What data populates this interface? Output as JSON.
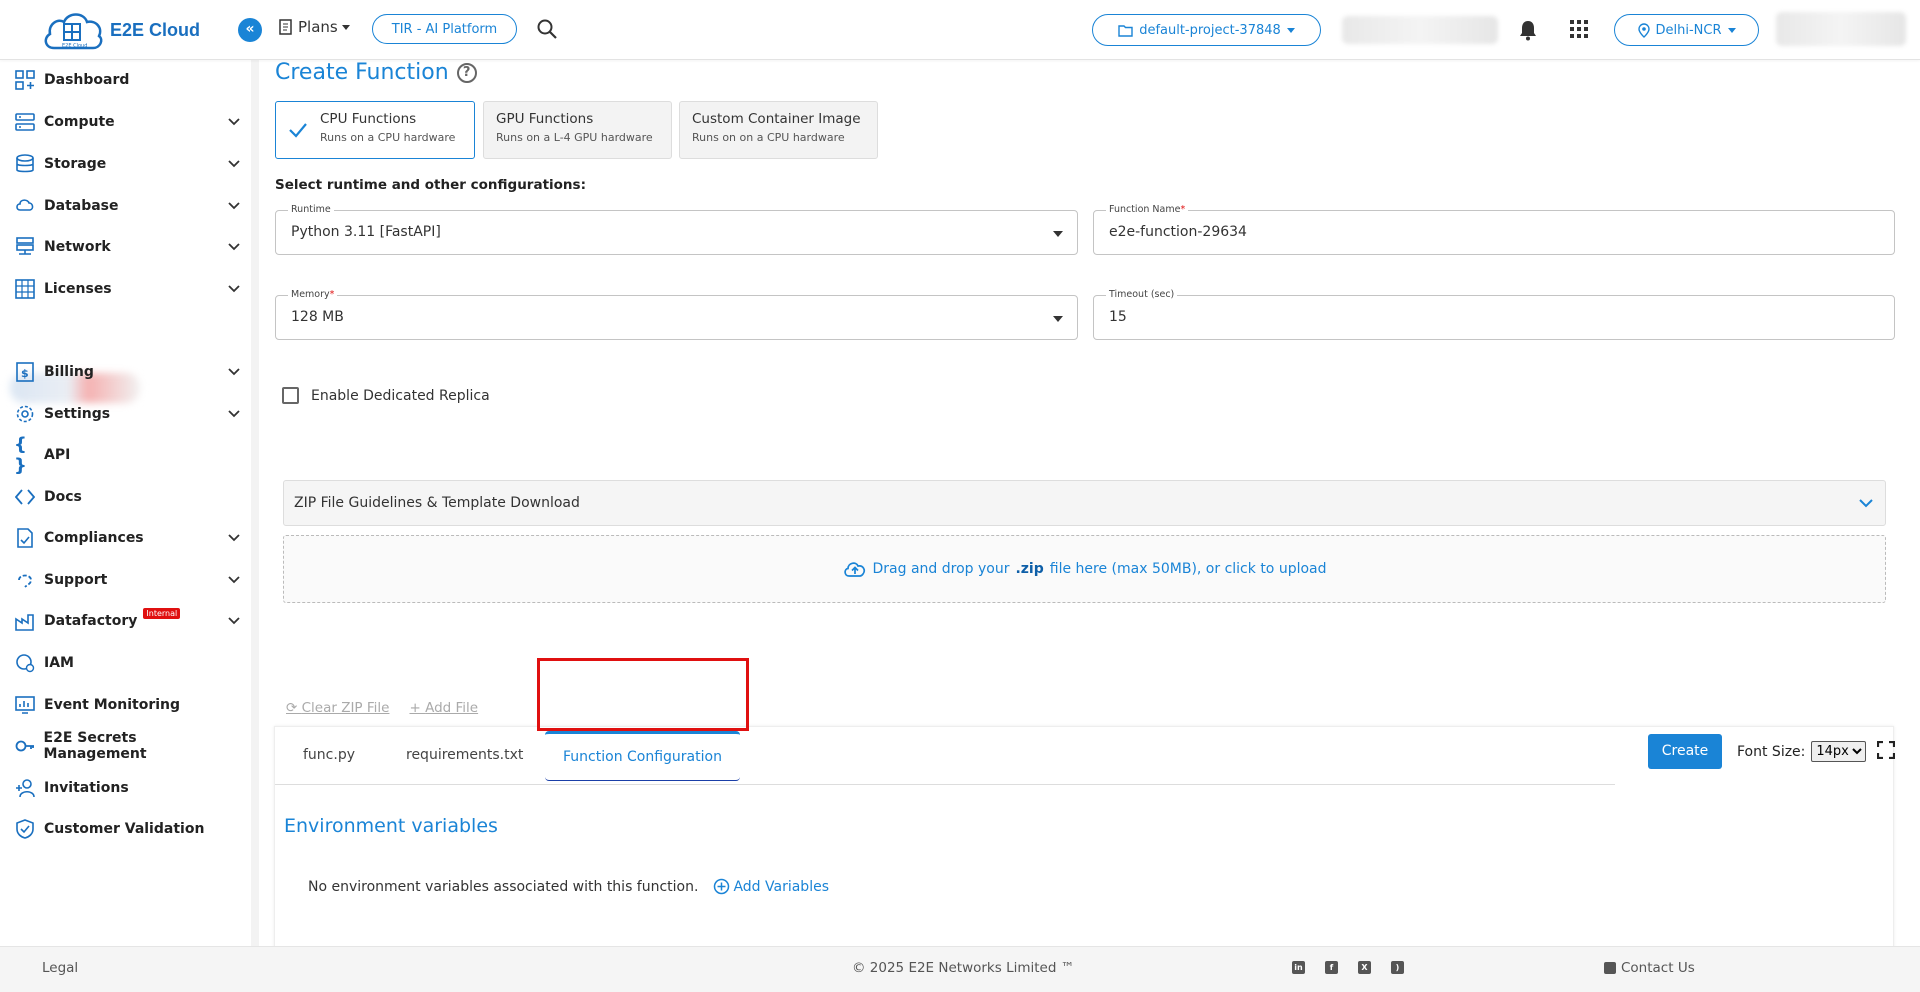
{
  "header": {
    "brand": "E2E Cloud",
    "logo_sub": "E2E Cloud",
    "plans_label": "Plans",
    "platform_label": "TIR - AI Platform",
    "project_label": "default-project-37848",
    "region_label": "Delhi-NCR"
  },
  "sidebar": {
    "items": [
      {
        "label": "Dashboard"
      },
      {
        "label": "Compute"
      },
      {
        "label": "Storage"
      },
      {
        "label": "Database"
      },
      {
        "label": "Network"
      },
      {
        "label": "Licenses"
      },
      {
        "label": "Billing"
      },
      {
        "label": "Settings"
      },
      {
        "label": "API"
      },
      {
        "label": "Docs"
      },
      {
        "label": "Compliances"
      },
      {
        "label": "Support"
      },
      {
        "label": "Datafactory",
        "badge": "Internal"
      },
      {
        "label": "IAM"
      },
      {
        "label": "Event Monitoring"
      },
      {
        "label": "E2E Secrets Management"
      },
      {
        "label": "Invitations"
      },
      {
        "label": "Customer Validation"
      }
    ]
  },
  "main": {
    "title": "Create Function",
    "function_types": [
      {
        "title": "CPU Functions",
        "subtitle": "Runs on a CPU hardware",
        "selected": true
      },
      {
        "title": "GPU Functions",
        "subtitle": "Runs on a L-4 GPU hardware",
        "selected": false
      },
      {
        "title": "Custom Container Image",
        "subtitle": "Runs on on a CPU hardware",
        "selected": false
      }
    ],
    "config_heading": "Select runtime and other configurations:",
    "fields": {
      "runtime": {
        "label": "Runtime",
        "value": "Python 3.11 [FastAPI]"
      },
      "function_name": {
        "label": "Function Name",
        "value": "e2e-function-29634",
        "required_mark": "*"
      },
      "memory": {
        "label": "Memory",
        "value": "128 MB",
        "required_mark": "*"
      },
      "timeout": {
        "label": "Timeout (sec)",
        "value": "15"
      }
    },
    "dedicated_replica_label": "Enable Dedicated Replica",
    "accordion_label": "ZIP File Guidelines & Template Download",
    "dropzone": {
      "prefix": "Drag and drop your",
      "ext": ".zip",
      "suffix": "file here (max 50MB), or click to upload"
    },
    "clear_zip_label": "Clear ZIP File",
    "add_file_label": "Add File",
    "editor": {
      "tabs": [
        "func.py",
        "requirements.txt",
        "Function Configuration"
      ],
      "active_tab": "Function Configuration",
      "create_label": "Create",
      "font_size_label": "Font Size:",
      "font_size_value": "14px",
      "env_title": "Environment variables",
      "env_empty_text": "No environment variables associated with this function.",
      "add_variables_label": "Add Variables"
    }
  },
  "footer": {
    "legal": "Legal",
    "copyright": "© 2025 E2E Networks Limited ™",
    "contact": "Contact Us"
  },
  "colors": {
    "accent": "#1a84d6",
    "highlight": "#e01010"
  }
}
